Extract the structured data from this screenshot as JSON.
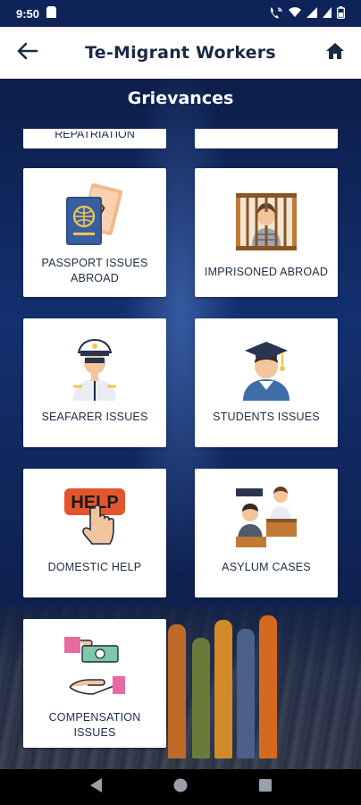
{
  "status_bar": {
    "time": "9:50"
  },
  "app_bar": {
    "title": "Te-Migrant Workers"
  },
  "section": {
    "title": "Grievances"
  },
  "cards_partial": [
    {
      "label": "REPATRIATION"
    },
    {
      "label": ""
    }
  ],
  "cards": [
    {
      "label": "PASSPORT ISSUES ABROAD",
      "icon": "passport-icon"
    },
    {
      "label": "IMPRISONED ABROAD",
      "icon": "prisoner-icon"
    },
    {
      "label": "SEAFARER ISSUES",
      "icon": "seafarer-icon"
    },
    {
      "label": "STUDENTS ISSUES",
      "icon": "graduate-student-icon"
    },
    {
      "label": "DOMESTIC HELP",
      "icon": "help-button-icon"
    },
    {
      "label": "ASYLUM CASES",
      "icon": "asylum-court-icon"
    },
    {
      "label": "COMPENSATION ISSUES",
      "icon": "money-hand-icon"
    }
  ],
  "colors": {
    "status_bar": "#0e2357",
    "app_bar": "#ffffff",
    "title_text": "#1a2a44",
    "background": "#10265a",
    "card": "#ffffff"
  }
}
